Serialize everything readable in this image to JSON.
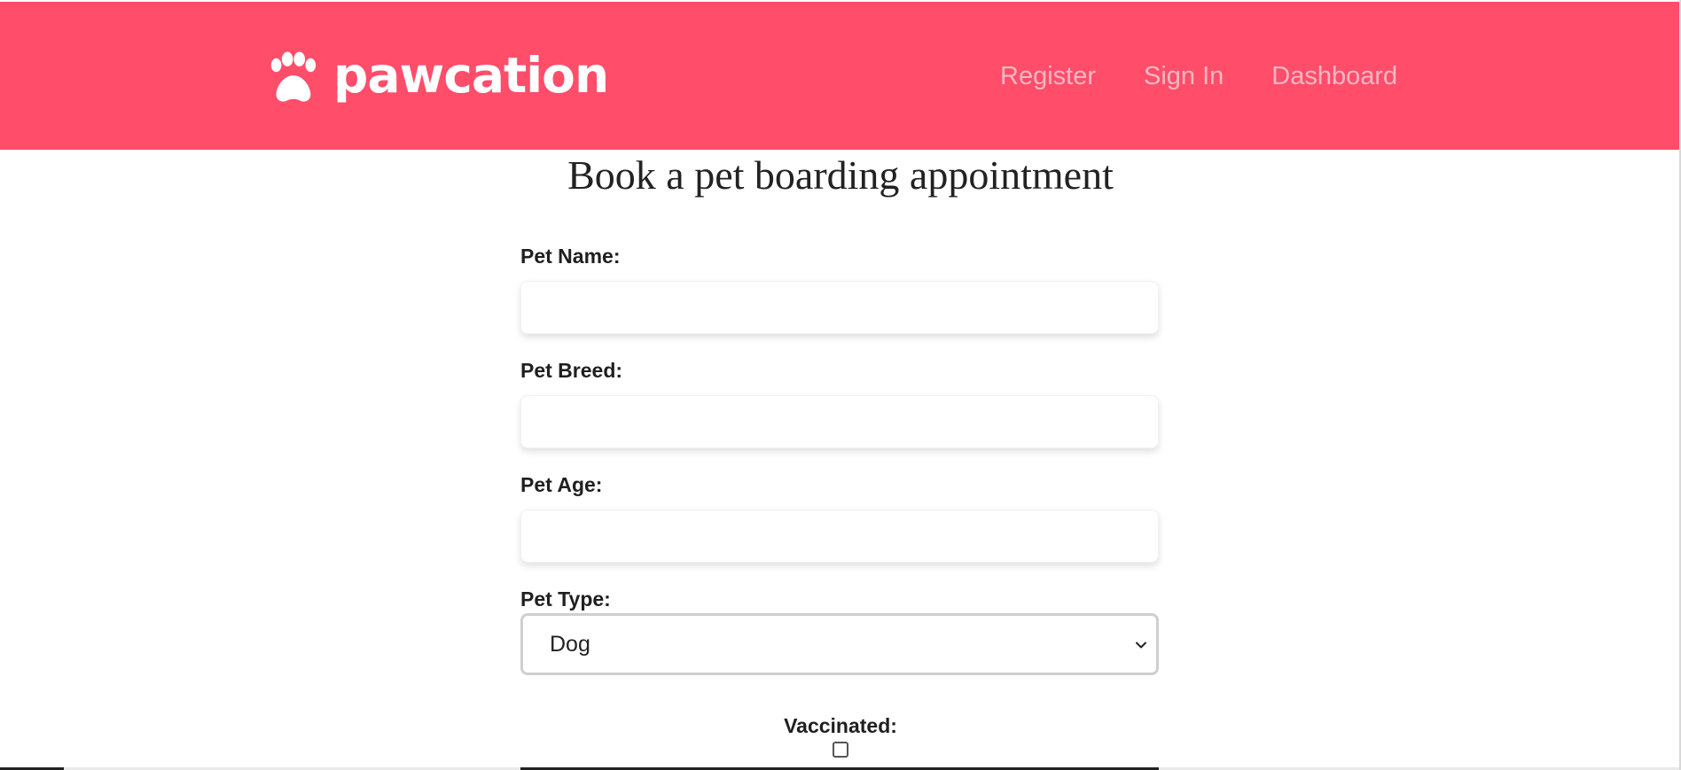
{
  "navbar": {
    "brand_name": "pawcation",
    "links": [
      "Register",
      "Sign In",
      "Dashboard"
    ],
    "background_color": "#ff4d6a",
    "link_color": "#f7b8c3"
  },
  "page": {
    "title": "Book a pet boarding appointment"
  },
  "form": {
    "pet_name_label": "Pet Name:",
    "pet_name_value": "",
    "pet_breed_label": "Pet Breed:",
    "pet_breed_value": "",
    "pet_age_label": "Pet Age:",
    "pet_age_value": "",
    "pet_type_label": "Pet Type:",
    "pet_type_selected": "Dog",
    "vaccinated_label": "Vaccinated:",
    "vaccinated_checked": false
  },
  "icons": {
    "brand": "paw-icon",
    "select": "chevron-down-icon"
  }
}
